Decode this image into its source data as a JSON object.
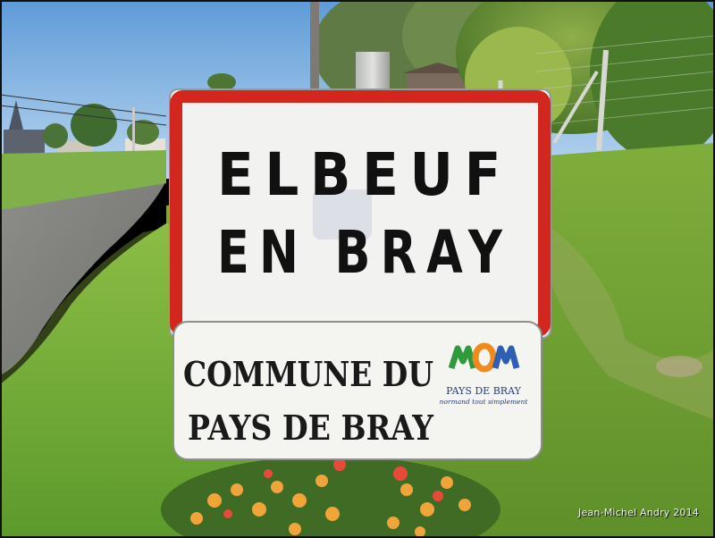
{
  "town_sign": {
    "line1": "ELBEUF",
    "line2": "EN BRAY",
    "border_color": "#d3261e",
    "background_color": "#f2f3f0"
  },
  "commune_sign": {
    "line1": "COMMUNE DU",
    "line2": "PAYS DE BRAY",
    "logo_name": "PAYS DE BRAY",
    "logo_tagline": "normand tout simplement",
    "logo_colors": [
      "#2e9a3b",
      "#f08a1c",
      "#2f5fb3"
    ]
  },
  "photo_credit": "Jean-Michel Andry 2014"
}
